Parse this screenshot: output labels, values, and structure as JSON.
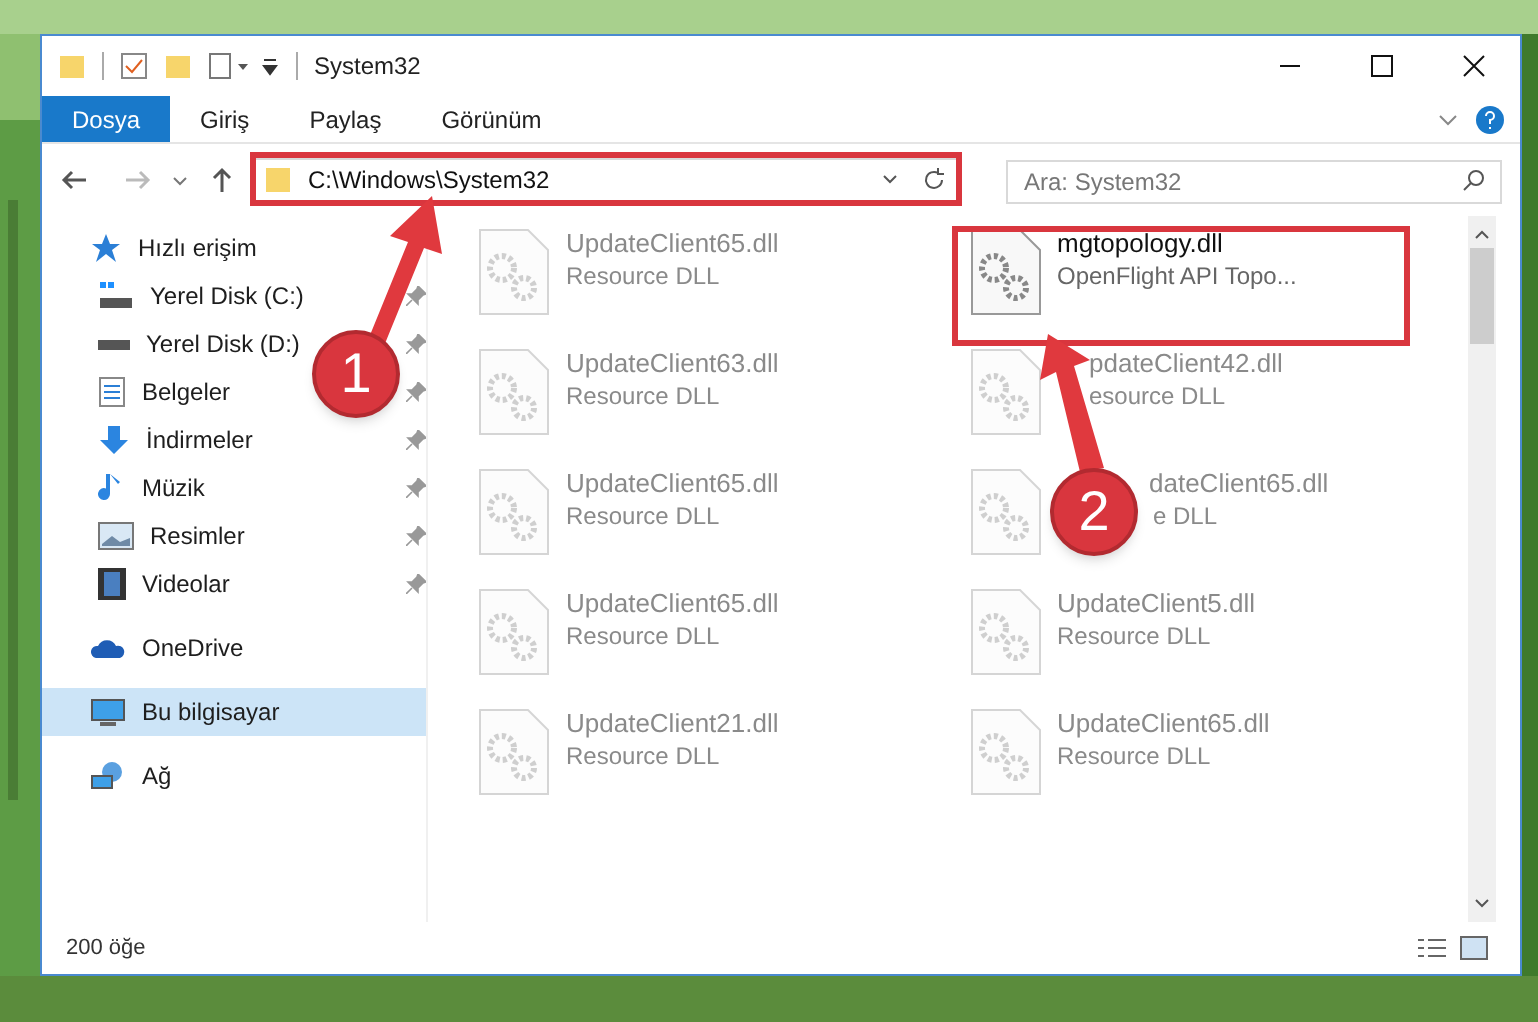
{
  "window": {
    "title": "System32"
  },
  "ribbon_tabs": [
    {
      "label": "Dosya",
      "selected": true
    },
    {
      "label": "Giriş",
      "selected": false
    },
    {
      "label": "Paylaş",
      "selected": false
    },
    {
      "label": "Görünüm",
      "selected": false
    }
  ],
  "address_bar": {
    "path": "C:\\Windows\\System32"
  },
  "search": {
    "placeholder": "Ara: System32"
  },
  "sidebar": [
    {
      "label": "Hızlı erişim",
      "selected": false,
      "children": [
        {
          "label": "Yerel Disk (C:)",
          "pinned": true,
          "selected": false
        },
        {
          "label": "Yerel Disk (D:)",
          "pinned": true,
          "selected": false
        },
        {
          "label": "Belgeler",
          "pinned": true,
          "selected": false
        },
        {
          "label": "İndirmeler",
          "pinned": true,
          "selected": false
        },
        {
          "label": "Müzik",
          "pinned": true,
          "selected": false
        },
        {
          "label": "Resimler",
          "pinned": true,
          "selected": false
        },
        {
          "label": "Videolar",
          "pinned": true,
          "selected": false
        }
      ]
    },
    {
      "label": "OneDrive",
      "selected": false
    },
    {
      "label": "Bu bilgisayar",
      "selected": true
    },
    {
      "label": "Ağ",
      "selected": false
    }
  ],
  "files": [
    {
      "name": "UpdateClient65.dll",
      "description": "Resource DLL",
      "blurred": true
    },
    {
      "name": "mgtopology.dll",
      "description": "OpenFlight API Topo...",
      "blurred": false
    },
    {
      "name": "UpdateClient63.dll",
      "description": "Resource DLL",
      "blurred": true
    },
    {
      "name": "pdateClient42.dll",
      "description": "esource DLL",
      "blurred": true
    },
    {
      "name": "UpdateClient65.dll",
      "description": "Resource DLL",
      "blurred": true
    },
    {
      "name": "dateClient65.dll",
      "description": "e DLL",
      "blurred": true
    },
    {
      "name": "UpdateClient65.dll",
      "description": "Resource DLL",
      "blurred": true
    },
    {
      "name": "UpdateClient5.dll",
      "description": "Resource DLL",
      "blurred": true
    },
    {
      "name": "UpdateClient21.dll",
      "description": "Resource DLL",
      "blurred": true
    },
    {
      "name": "UpdateClient65.dll",
      "description": "Resource DLL",
      "blurred": true
    }
  ],
  "status_bar": {
    "item_count": "200 öğe"
  },
  "annotations": [
    {
      "label": "1"
    },
    {
      "label": "2"
    }
  ]
}
